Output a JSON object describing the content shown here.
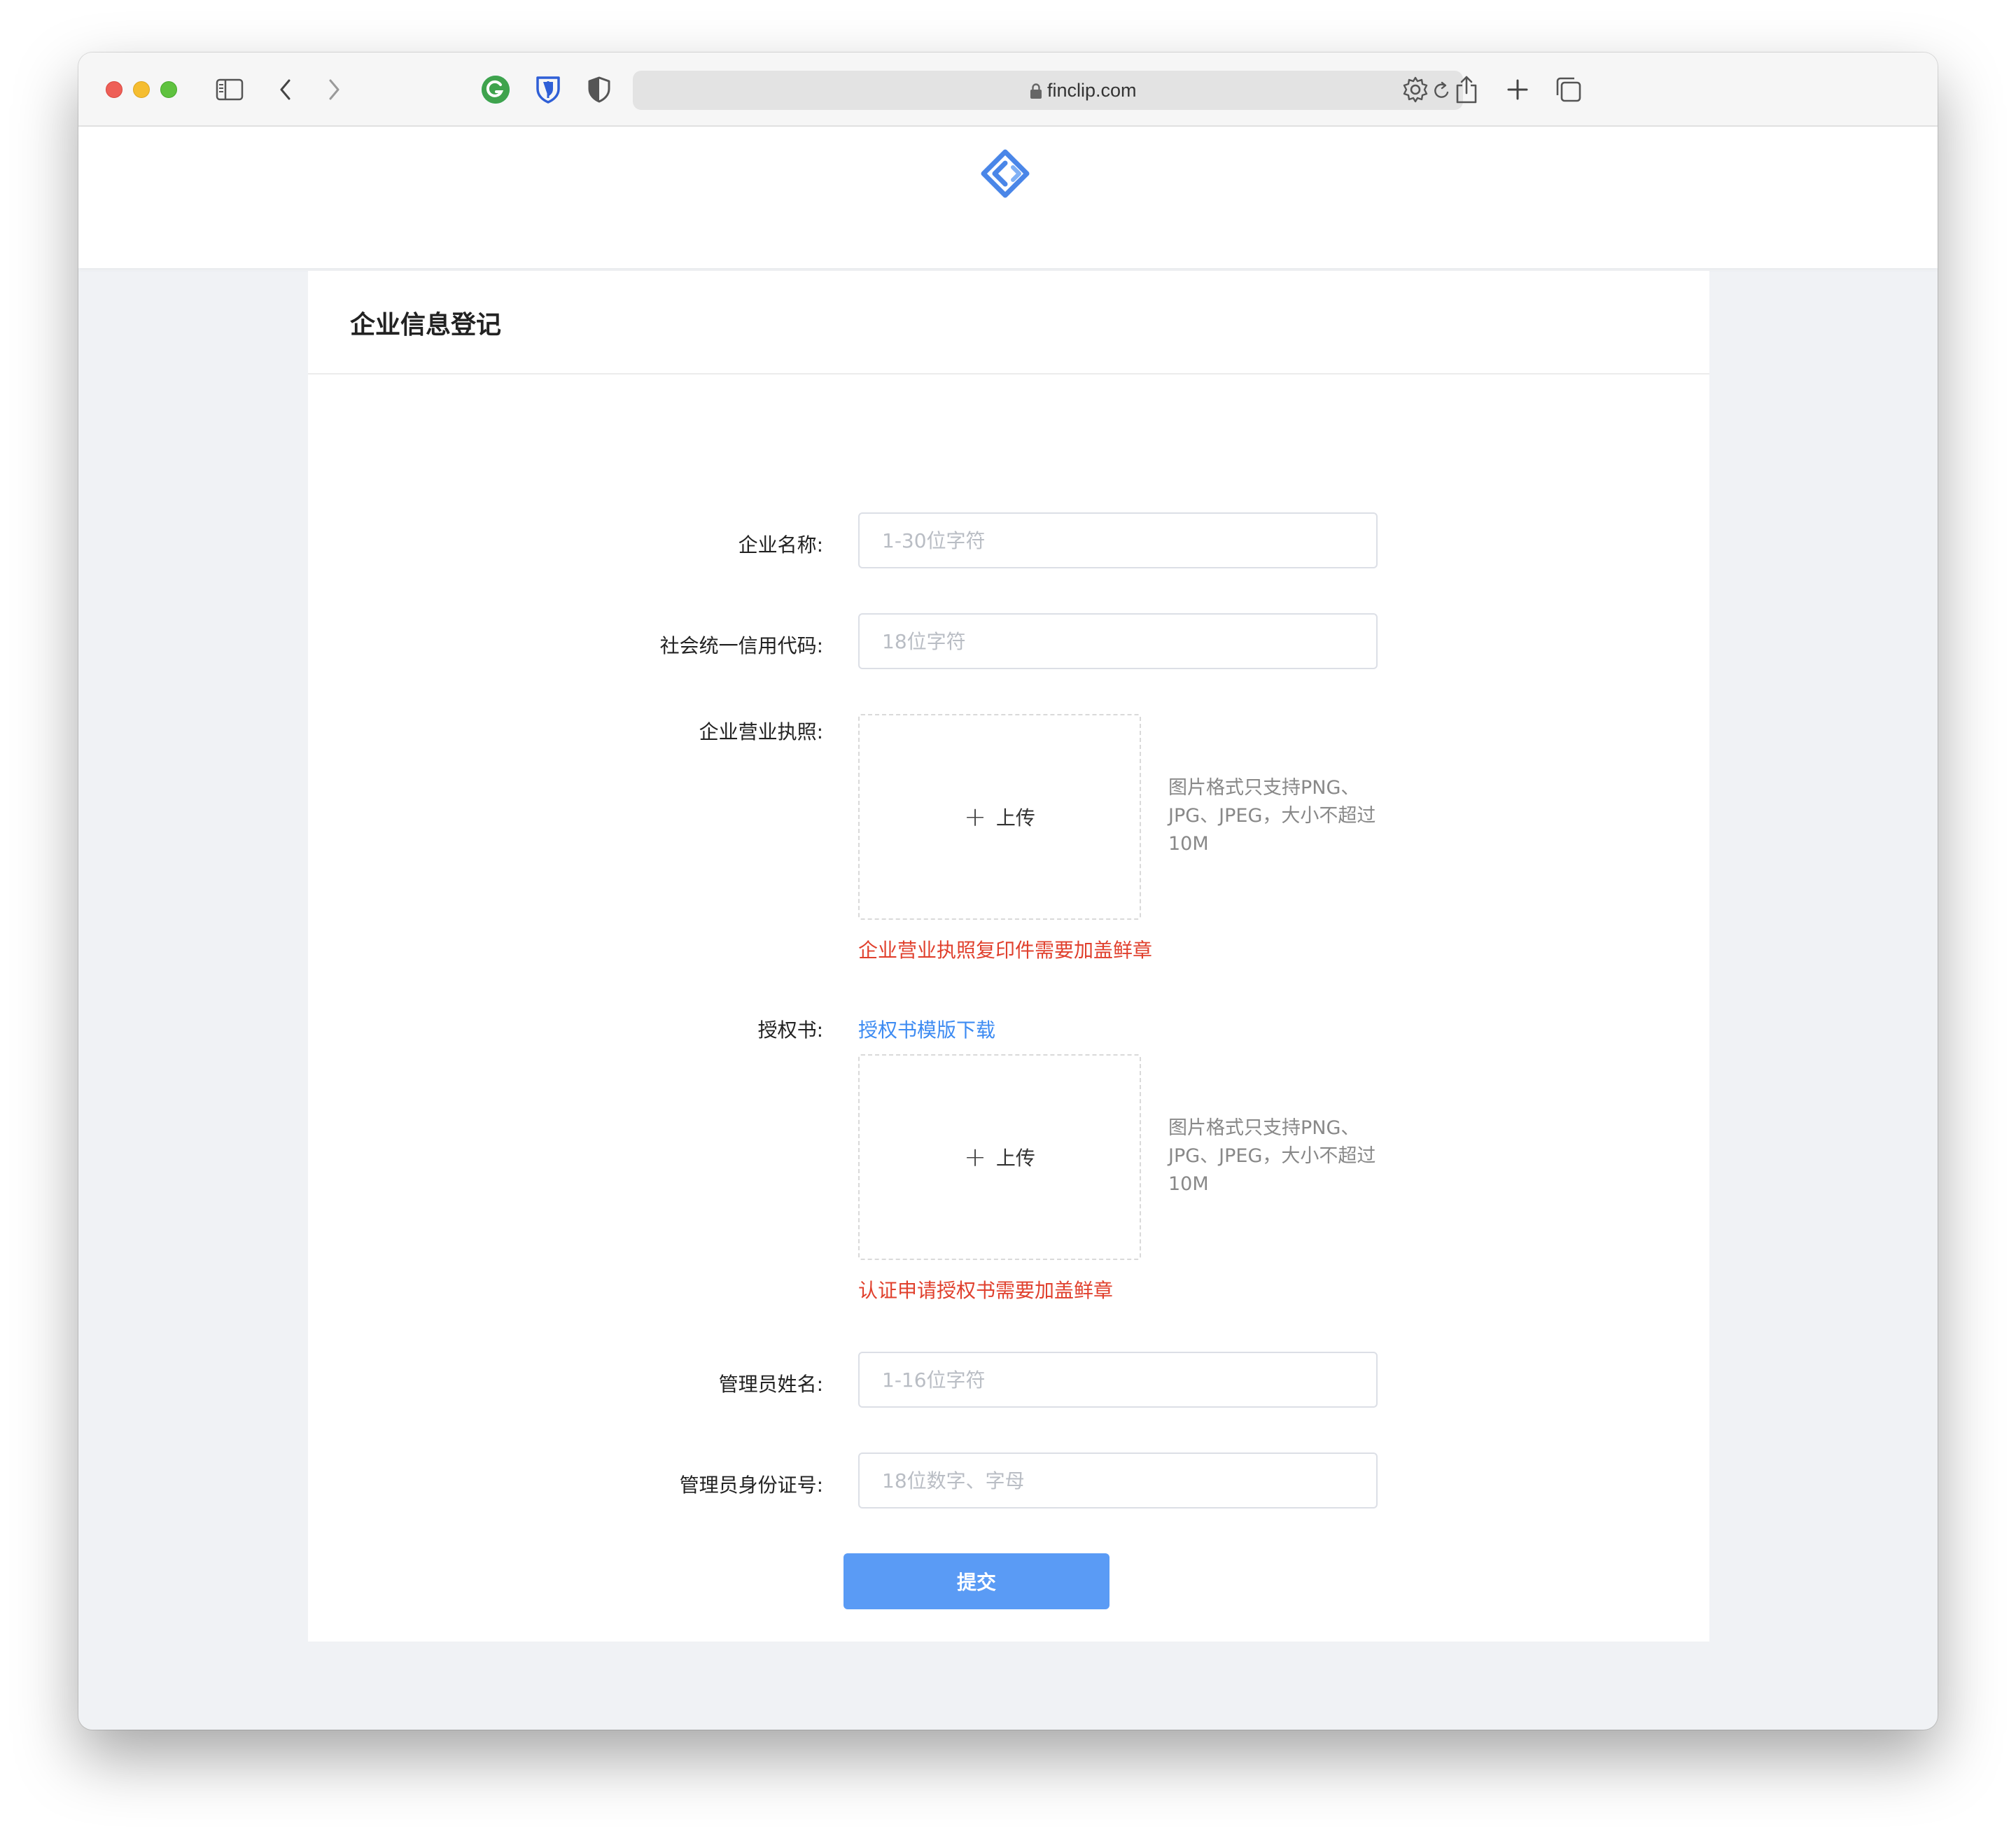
{
  "browser": {
    "url": "finclip.com"
  },
  "page": {
    "title": "企业信息登记",
    "fields": {
      "company_name": {
        "label": "企业名称:",
        "placeholder": "1-30位字符",
        "value": ""
      },
      "credit_code": {
        "label": "社会统一信用代码:",
        "placeholder": "18位字符",
        "value": ""
      },
      "license": {
        "label": "企业营业执照:",
        "upload_label": "上传",
        "hint": "图片格式只支持PNG、JPG、JPEG，大小不超过10M",
        "warning": "企业营业执照复印件需要加盖鲜章"
      },
      "authorization": {
        "label": "授权书:",
        "template_link": "授权书模版下载",
        "upload_label": "上传",
        "hint": "图片格式只支持PNG、JPG、JPEG，大小不超过10M",
        "warning": "认证申请授权书需要加盖鲜章"
      },
      "admin_name": {
        "label": "管理员姓名:",
        "placeholder": "1-16位字符",
        "value": ""
      },
      "admin_id": {
        "label": "管理员身份证号:",
        "placeholder": "18位数字、字母",
        "value": ""
      }
    },
    "submit_label": "提交"
  },
  "colors": {
    "primary": "#5a9bf5",
    "link": "#3d8bf2",
    "warning": "#e0402d",
    "logo": "#4a86e8",
    "page_bg": "#f0f2f5"
  }
}
